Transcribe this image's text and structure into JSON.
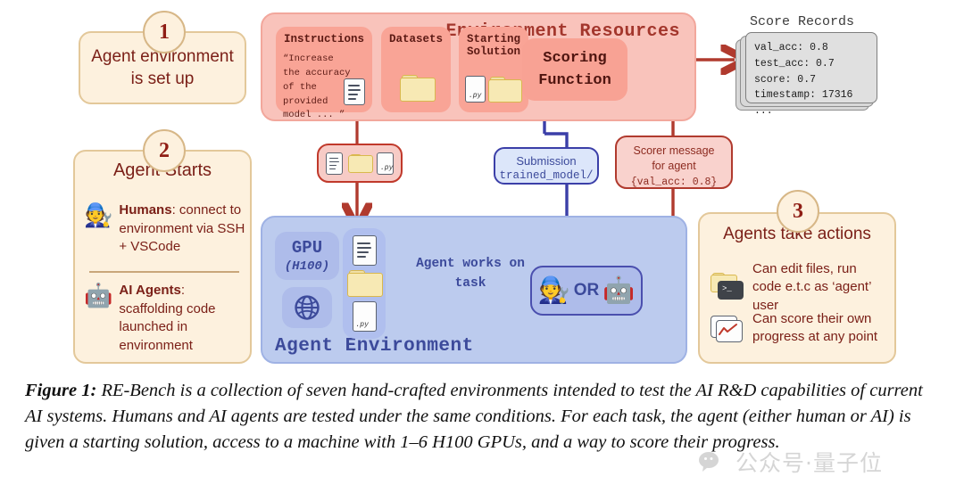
{
  "steps": [
    {
      "number": "1",
      "title": "Agent environment\nis set up"
    },
    {
      "number": "2",
      "title": "Agent Starts"
    },
    {
      "number": "3",
      "title": "Agents take actions"
    }
  ],
  "step1": {
    "number": "1",
    "line1": "Agent environment",
    "line2": "is set up"
  },
  "step2": {
    "number": "2",
    "title": "Agent Starts",
    "rows": [
      {
        "icon": "person-mechanic-emoji",
        "bold": "Humans",
        "text": ": connect to environment via SSH + VSCode"
      },
      {
        "icon": "robot-emoji",
        "bold": "AI Agents",
        "text": ": scaffolding code launched in environment"
      }
    ]
  },
  "step3": {
    "number": "3",
    "title": "Agents take actions",
    "rows": [
      {
        "icon": "terminal-folder-icon",
        "text": "Can edit files, run code e.t.c as ‘agent’ user"
      },
      {
        "icon": "score-chart-icon",
        "text": "Can score their own progress at any point"
      }
    ]
  },
  "environment_resources": {
    "title": "Environment Resources",
    "cards": [
      {
        "title": "Instructions",
        "quote": "“Increase\nthe accuracy\nof the\nprovided\nmodel ... ”",
        "icon": "document-icon"
      },
      {
        "title": "Datasets",
        "icon": "folder-icon"
      },
      {
        "title": "Starting\nSolution",
        "icon": "py-file-and-folder-icon"
      }
    ],
    "scoring_function": "Scoring\nFunction"
  },
  "score_records": {
    "title": "Score Records",
    "lines": [
      "val_acc: 0.8",
      "test_acc: 0.7",
      "score: 0.7",
      "timestamp: 17316 ..."
    ]
  },
  "agent_environment": {
    "title": "Agent Environment",
    "gpu_label": "GPU",
    "gpu_model": "(H100)",
    "globe_icon": "globe-icon",
    "files": [
      "document-icon",
      "folder-icon",
      "py-file-icon"
    ],
    "works_on_task": "Agent works on\ntask",
    "works_line1": "Agent works on",
    "works_line2": "task",
    "actor": {
      "human_icon": "person-mechanic-emoji",
      "or_label": "OR",
      "ai_icon": "robot-emoji"
    }
  },
  "pills": {
    "resources_chip_icons": [
      "document-icon",
      "folder-icon",
      "py-file-icon"
    ],
    "submission": {
      "line1": "Submission",
      "line2": "trained_model/"
    },
    "scorer_message": {
      "line1": "Scorer message",
      "line2": "for agent",
      "line3": "{val_acc: 0.8}"
    }
  },
  "caption": {
    "label": "Figure 1:",
    "text": " RE-Bench is a collection of seven hand-crafted environments intended to test the AI R&D capabilities of current AI systems. Humans and AI agents are tested under the same conditions. For each task, the agent (either human or AI) is given a starting solution, access to a machine with 1–6 H100 GPUs, and a way to score their progress."
  },
  "watermark": {
    "text": "公众号·量子位",
    "icon": "wechat-bubble-icon"
  },
  "colors": {
    "tan_fill": "#fdf1de",
    "tan_border": "#e3c89a",
    "dark_red_text": "#7b2018",
    "env_res_fill": "#f9c3bb",
    "env_res_card": "#f9a496",
    "agent_env_fill": "#bccbee",
    "agent_env_border": "#9fb2e4",
    "blue_text": "#3c4a9b",
    "red_arrow": "#b03a2e",
    "blue_arrow": "#3b3fa8",
    "records_fill": "#e0e0e0"
  }
}
